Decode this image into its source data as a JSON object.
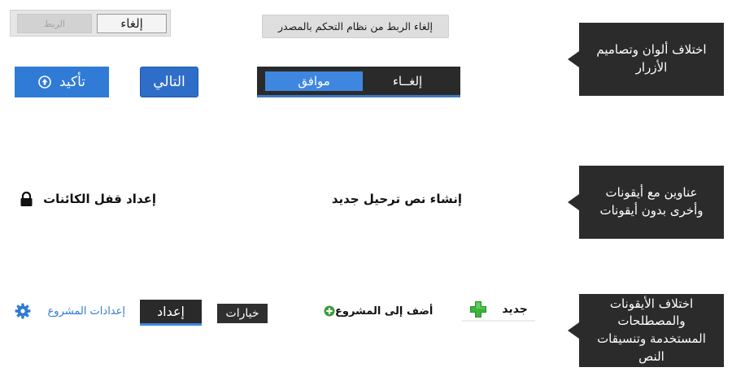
{
  "callouts": {
    "buttons": "اختلاف ألوان وتصاميم الأزرار",
    "headings": "عناوين مع أيقونات وأخرى بدون أيقونات",
    "icons_terms": "اختلاف الأيقونات والمصطلحات المستخدمة وتنسيقات النص"
  },
  "row1": {
    "cancel_label": "إلغاء",
    "link_disabled_label": "الربط",
    "unlink_source_label": "إلغاء الربط من نظام التحكم بالمصدر"
  },
  "row2": {
    "confirm_label": "تأكيد",
    "next_label": "التالي",
    "cancel_label": "إلغــاء",
    "ok_label": "موافق"
  },
  "headings": {
    "object_lock_title": "إعداد قفل الكائنات",
    "migration_script_title": "إنشاء نص ترحيل جديد"
  },
  "row4": {
    "project_settings_label": "إعدادات المشروع",
    "setup_tab_label": "إعداد",
    "options_label": "خيارات",
    "add_to_project_label": "أضف إلى المشروع",
    "new_label": "جديد"
  },
  "colors": {
    "callout_bg": "#2b2b2b",
    "primary_blue": "#2f7bd6",
    "dark_toolbar": "#2a2a2a",
    "link_blue": "#2e7bcf",
    "green_plus": "#3cb43c"
  },
  "icons": [
    "up-arrow-circle-icon",
    "lock-icon",
    "gear-icon",
    "add-circle-icon",
    "green-plus-icon"
  ]
}
